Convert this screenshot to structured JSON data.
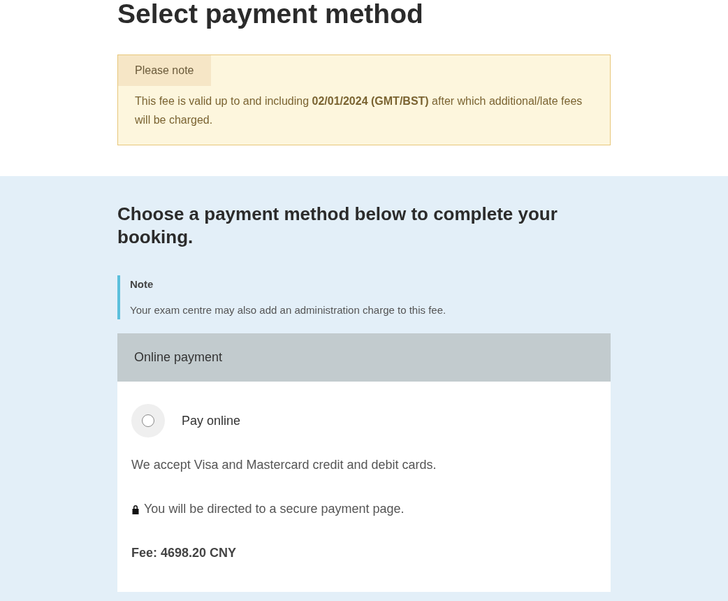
{
  "title": "Select payment method",
  "notice": {
    "label": "Please note",
    "text": "This fee is valid up to and including **02/01/2024 (GMT/BST)** after which additional/late fees will be charged."
  },
  "section": {
    "heading": "Choose a payment method below to complete your booking.",
    "note": {
      "label": "Note",
      "text": "Your exam centre may also add an administration charge to this fee."
    },
    "panel": {
      "header": "Online payment",
      "option": {
        "label": "Pay online",
        "selected": false
      },
      "accept_text": "We accept Visa and Mastercard credit and debit cards.",
      "secure_text": "You will be directed to a secure payment page.",
      "fee": "Fee: 4698.20 CNY"
    }
  }
}
